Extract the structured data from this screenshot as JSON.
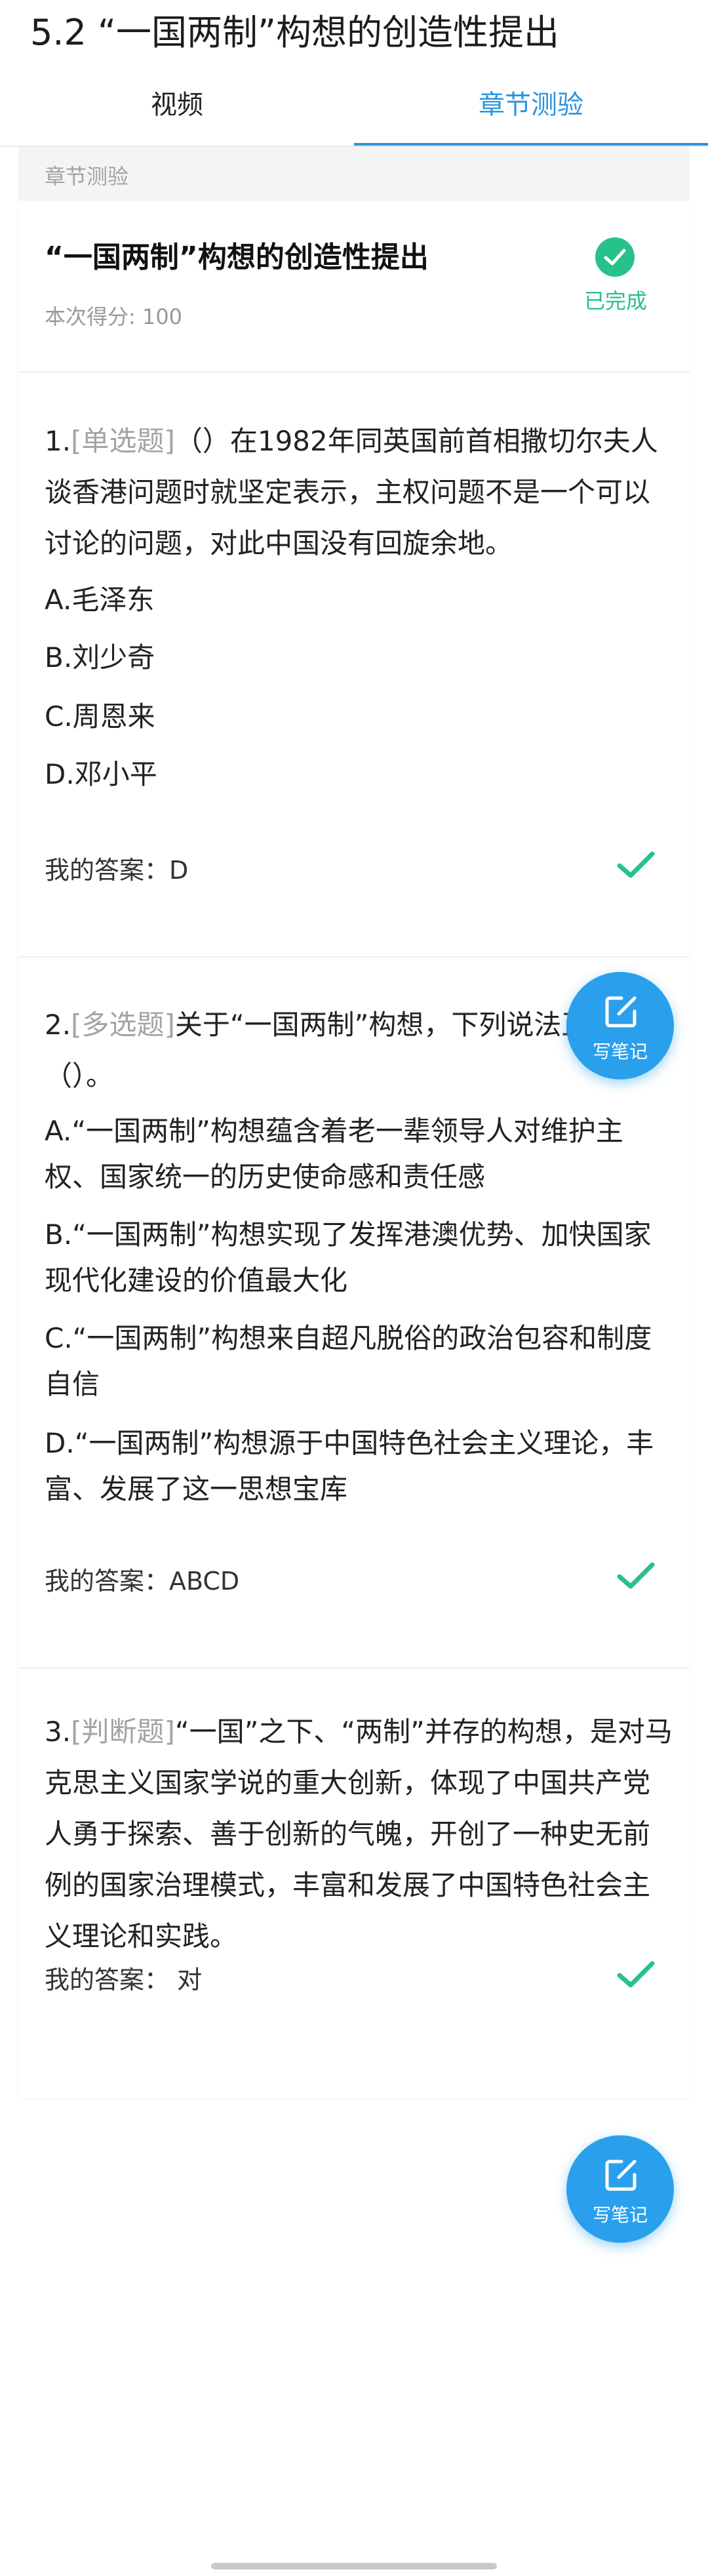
{
  "header": {
    "title": "5.2 “一国两制”构想的创造性提出"
  },
  "tabs": [
    {
      "label": "视频"
    },
    {
      "label": "章节测验"
    }
  ],
  "section": {
    "label": "章节测验"
  },
  "quiz": {
    "title": "“一国两制”构想的创造性提出",
    "score": "本次得分: 100",
    "status": "已完成"
  },
  "questions": [
    {
      "number": "1.",
      "type": "[单选题]",
      "stem": "（）在1982年同英国前首相撒切尔夫人谈香港问题时就坚定表示，主权问题不是一个可以讨论的问题，对此中国没有回旋余地。",
      "options": [
        "A.毛泽东",
        "B.刘少奇",
        "C.周恩来",
        "D.邓小平"
      ],
      "answer": "我的答案：D"
    },
    {
      "number": "2.",
      "type": "[多选题]",
      "stem": "关于“一国两制”构想，下列说法正确的有（）。",
      "options": [
        "A.“一国两制”构想蕴含着老一辈领导人对维护主权、国家统一的历史使命感和责任感",
        "B.“一国两制”构想实现了发挥港澳优势、加快国家现代化建设的价值最大化",
        "C.“一国两制”构想来自超凡脱俗的政治包容和制度自信",
        "D.“一国两制”构想源于中国特色社会主义理论，丰富、发展了这一思想宝库"
      ],
      "answer": "我的答案：ABCD"
    },
    {
      "number": "3.",
      "type": "[判断题]",
      "stem": "“一国”之下、“两制”并存的构想，是对马克思主义国家学说的重大创新，体现了中国共产党人勇于探索、善于创新的气魄，开创了一种史无前例的国家治理模式，丰富和发展了中国特色社会主义理论和实践。",
      "options": [],
      "answer": "我的答案： 对"
    }
  ],
  "note_button": {
    "label": "写笔记",
    "icon": "edit-note-icon"
  },
  "colors": {
    "accent": "#2a95e0",
    "success": "#27c189",
    "note_button": "#2aa0ec"
  }
}
